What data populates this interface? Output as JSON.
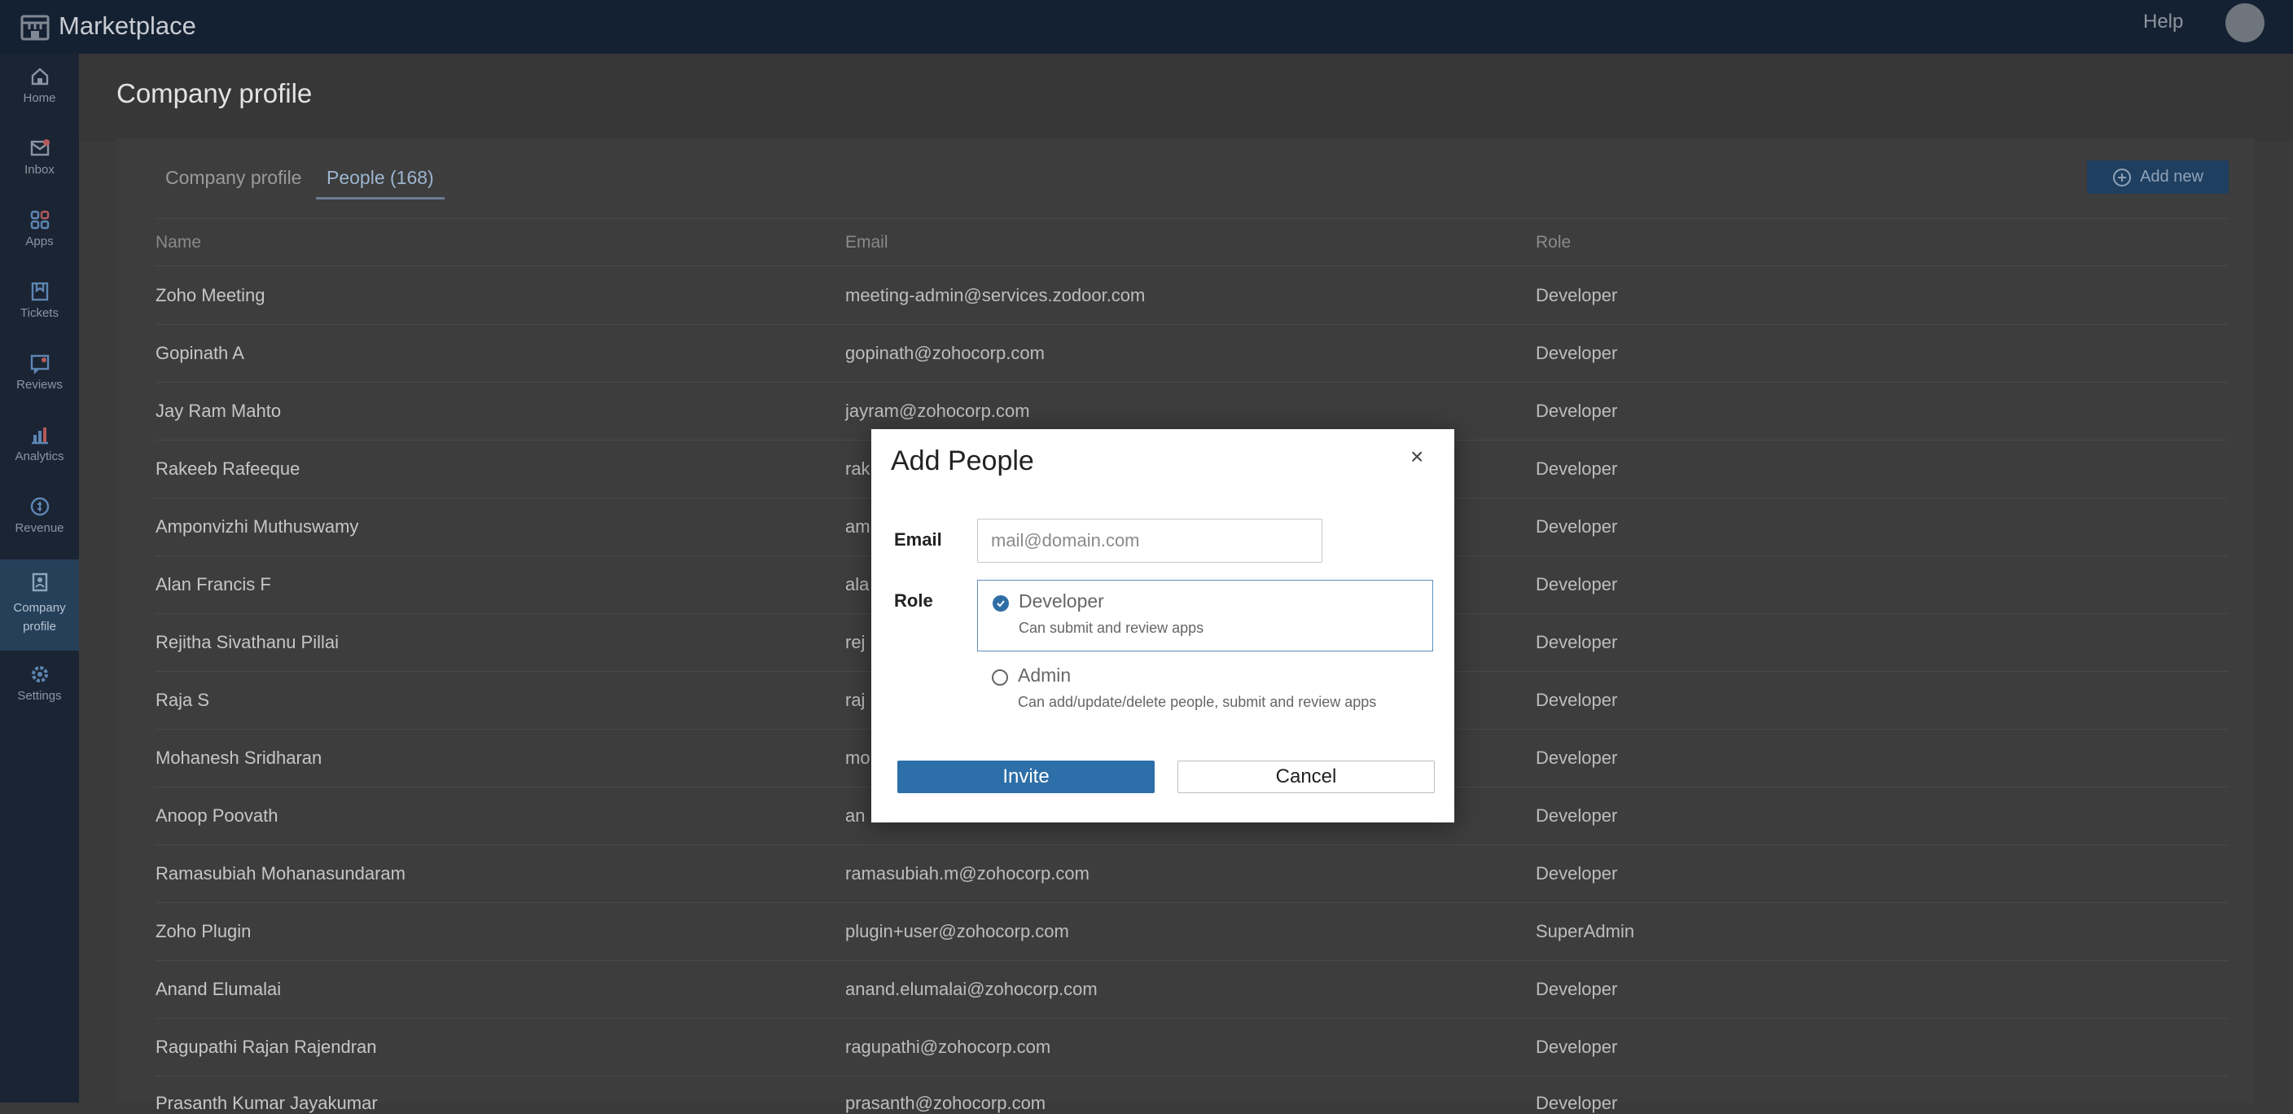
{
  "topbar": {
    "brand": "Marketplace",
    "help": "Help",
    "logo_icon": "store-icon"
  },
  "sidebar": {
    "items": [
      {
        "label": "Home",
        "icon": "home-icon"
      },
      {
        "label": "Inbox",
        "icon": "inbox-icon"
      },
      {
        "label": "Apps",
        "icon": "apps-grid-icon"
      },
      {
        "label": "Tickets",
        "icon": "ticket-icon"
      },
      {
        "label": "Reviews",
        "icon": "review-icon"
      },
      {
        "label": "Analytics",
        "icon": "chart-icon"
      },
      {
        "label": "Revenue",
        "icon": "revenue-icon"
      },
      {
        "label": "Company profile",
        "icon": "profile-icon",
        "active": true
      },
      {
        "label": "Settings",
        "icon": "gear-icon"
      }
    ]
  },
  "page": {
    "title": "Company profile",
    "tabs": [
      {
        "label": "Company profile",
        "active": false
      },
      {
        "label": "People (168)",
        "active": true
      }
    ],
    "add_new": "Add new"
  },
  "table": {
    "headers": {
      "name": "Name",
      "email": "Email",
      "role": "Role"
    },
    "rows": [
      {
        "name": "Zoho Meeting",
        "email": "meeting-admin@services.zodoor.com",
        "role": "Developer"
      },
      {
        "name": "Gopinath A",
        "email": "gopinath@zohocorp.com",
        "role": "Developer"
      },
      {
        "name": "Jay Ram Mahto",
        "email": "jayram@zohocorp.com",
        "role": "Developer"
      },
      {
        "name": "Rakeeb Rafeeque",
        "email": "rak",
        "role": "Developer"
      },
      {
        "name": "Amponvizhi Muthuswamy",
        "email": "am",
        "role": "Developer"
      },
      {
        "name": "Alan Francis F",
        "email": "ala",
        "role": "Developer"
      },
      {
        "name": "Rejitha Sivathanu Pillai",
        "email": "rej",
        "role": "Developer"
      },
      {
        "name": "Raja S",
        "email": "raj",
        "role": "Developer"
      },
      {
        "name": "Mohanesh Sridharan",
        "email": "mo",
        "role": "Developer"
      },
      {
        "name": "Anoop Poovath",
        "email": "an",
        "role": "Developer"
      },
      {
        "name": "Ramasubiah Mohanasundaram",
        "email": "ramasubiah.m@zohocorp.com",
        "role": "Developer"
      },
      {
        "name": "Zoho Plugin",
        "email": "plugin+user@zohocorp.com",
        "role": "SuperAdmin"
      },
      {
        "name": "Anand Elumalai",
        "email": "anand.elumalai@zohocorp.com",
        "role": "Developer"
      },
      {
        "name": "Ragupathi Rajan Rajendran",
        "email": "ragupathi@zohocorp.com",
        "role": "Developer"
      },
      {
        "name": "Prasanth Kumar Jayakumar",
        "email": "prasanth@zohocorp.com",
        "role": "Developer"
      }
    ]
  },
  "modal": {
    "title": "Add People",
    "close": "×",
    "email_label": "Email",
    "email_placeholder": "mail@domain.com",
    "email_value": "",
    "role_label": "Role",
    "roles": [
      {
        "title": "Developer",
        "desc": "Can submit and review apps",
        "selected": true
      },
      {
        "title": "Admin",
        "desc": "Can add/update/delete people, submit and review apps",
        "selected": false
      }
    ],
    "invite": "Invite",
    "cancel": "Cancel"
  },
  "colors": {
    "topbar": "#142133",
    "sidebar": "#1b2433",
    "accent": "#2d6fa8",
    "overlay_bg": "#3a3a3a"
  }
}
